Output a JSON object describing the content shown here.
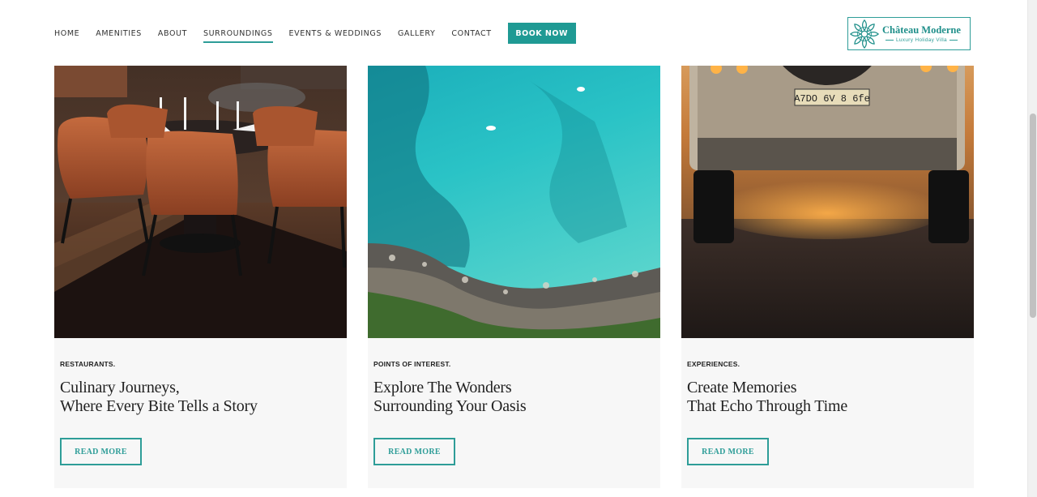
{
  "nav": {
    "items": [
      {
        "label": "HOME",
        "active": false
      },
      {
        "label": "AMENITIES",
        "active": false
      },
      {
        "label": "ABOUT",
        "active": false
      },
      {
        "label": "SURROUNDINGS",
        "active": true
      },
      {
        "label": "EVENTS & WEDDINGS",
        "active": false
      },
      {
        "label": "GALLERY",
        "active": false
      },
      {
        "label": "CONTACT",
        "active": false
      }
    ],
    "book_label": "BOOK NOW"
  },
  "logo": {
    "title": "Château Moderne",
    "subtitle": "Luxury Holiday Villa",
    "icon": "lotus-mandala-icon"
  },
  "colors": {
    "accent": "#1f9a94",
    "card_bg": "#f7f7f7",
    "text": "#222222"
  },
  "cards": [
    {
      "category": "RESTAURANTS.",
      "title_line1": "Culinary Journeys,",
      "title_line2": "Where Every Bite Tells a Story",
      "button": "READ MORE",
      "image": "restaurant-interior-photo"
    },
    {
      "category": "POINTS OF INTEREST.",
      "title_line1": "Explore The Wonders",
      "title_line2": "Surrounding Your Oasis",
      "button": "READ MORE",
      "image": "aerial-turquoise-bay-photo"
    },
    {
      "category": "EXPERIENCES.",
      "title_line1": "Create Memories",
      "title_line2": "That Echo Through Time",
      "button": "READ MORE",
      "image": "offroad-vehicle-rear-photo"
    }
  ],
  "vehicle_plate": "A7DO 6V 8 6fe"
}
